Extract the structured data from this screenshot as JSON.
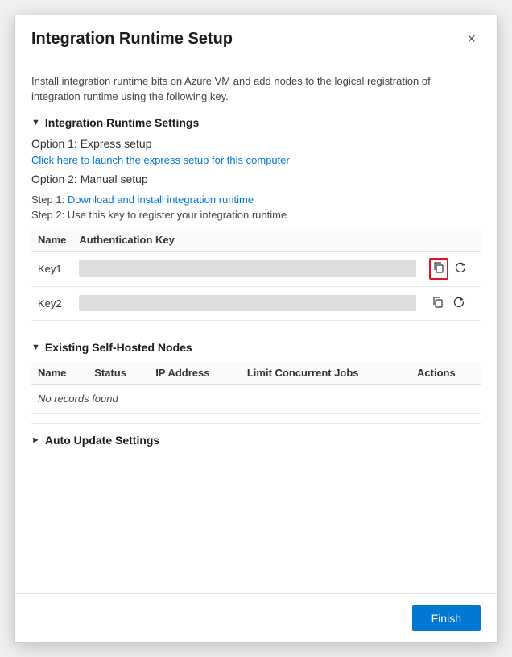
{
  "dialog": {
    "title": "Integration Runtime Setup",
    "close_label": "×",
    "description": "Install integration runtime bits on Azure VM and add nodes to the logical registration of integration runtime using the following key."
  },
  "integration_runtime_settings": {
    "section_title": "Integration Runtime Settings",
    "option1_title": "Option 1: Express setup",
    "option1_link": "Click here to launch the express setup for this computer",
    "option2_title": "Option 2: Manual setup",
    "step1_text": "Step 1:",
    "step1_link": "Download and install integration runtime",
    "step2_text": "Step 2: Use this key to register your integration runtime",
    "table": {
      "col_name": "Name",
      "col_key": "Authentication Key",
      "rows": [
        {
          "name": "Key1"
        },
        {
          "name": "Key2"
        }
      ]
    }
  },
  "existing_nodes": {
    "section_title": "Existing Self-Hosted Nodes",
    "col_name": "Name",
    "col_status": "Status",
    "col_ip": "IP Address",
    "col_limit": "Limit Concurrent Jobs",
    "col_actions": "Actions",
    "no_records": "No records found"
  },
  "auto_update": {
    "section_title": "Auto Update Settings"
  },
  "footer": {
    "finish_label": "Finish"
  }
}
